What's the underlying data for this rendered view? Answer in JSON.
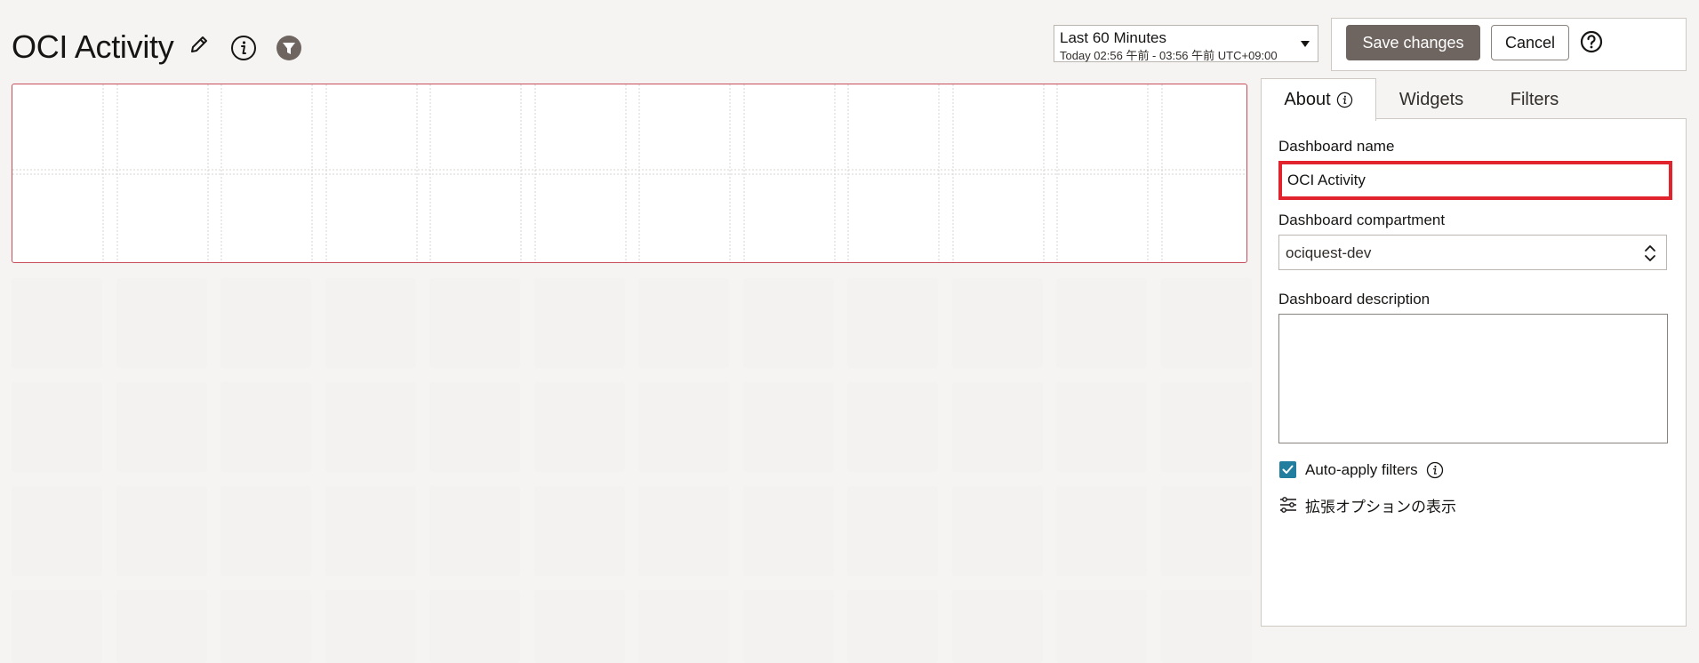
{
  "header": {
    "title": "OCI Activity",
    "time_range": {
      "label": "Last 60 Minutes",
      "detail": "Today 02:56 午前 - 03:56 午前 UTC+09:00"
    },
    "save_label": "Save changes",
    "cancel_label": "Cancel"
  },
  "icons": {
    "edit": "pencil-icon",
    "info": "info-icon",
    "filter": "filter-icon",
    "help": "help-icon"
  },
  "panel": {
    "tabs": [
      {
        "label": "About",
        "active": true
      },
      {
        "label": "Widgets",
        "active": false
      },
      {
        "label": "Filters",
        "active": false
      }
    ],
    "dashboard_name_label": "Dashboard name",
    "dashboard_name_value": "OCI Activity",
    "compartment_label": "Dashboard compartment",
    "compartment_value": "ociquest-dev",
    "description_label": "Dashboard description",
    "description_value": "",
    "auto_apply_label": "Auto-apply filters",
    "auto_apply_checked": true,
    "extended_options_label": "拡張オプションの表示"
  },
  "colors": {
    "accent_checkbox": "#227e9e",
    "save_button": "#6f6560",
    "focus_highlight": "#e0232c",
    "selected_widget_border": "#c74f5b"
  }
}
